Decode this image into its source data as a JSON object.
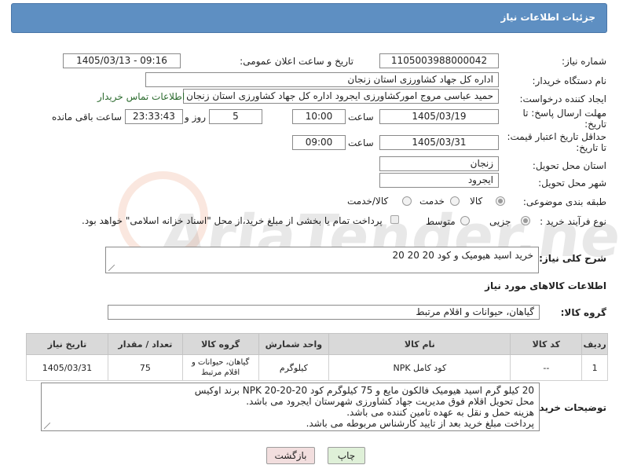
{
  "header": {
    "title": "جزئیات اطلاعات نیاز"
  },
  "form": {
    "need_number": {
      "label": "شماره نیاز:",
      "value": "1105003988000042"
    },
    "announce_datetime": {
      "label": "تاریخ و ساعت اعلان عمومی:",
      "value": "1405/03/13 - 09:16"
    },
    "buyer_org": {
      "label": "نام دستگاه خریدار:",
      "value": "اداره کل جهاد کشاورزی استان زنجان"
    },
    "creator": {
      "label": "ایجاد کننده درخواست:",
      "value": "حمید عباسی مروج امورکشاورزی ایجرود اداره کل جهاد کشاورزی استان زنجان",
      "contact_link": "اطلاعات تماس خریدار"
    },
    "reply_deadline": {
      "label_line1": "مهلت ارسال پاسخ: تا",
      "label_line2": "تاریخ:",
      "date": "1405/03/19",
      "time_label": "ساعت",
      "time": "10:00",
      "days": "5",
      "days_label": "روز و",
      "remaining": "23:33:43",
      "remaining_label": "ساعت باقی مانده"
    },
    "price_validity": {
      "label_line1": "حداقل تاریخ اعتبار قیمت:",
      "label_line2": "تا تاریخ:",
      "date": "1405/03/31",
      "time_label": "ساعت",
      "time": "09:00"
    },
    "province": {
      "label": "استان محل تحویل:",
      "value": "زنجان"
    },
    "city": {
      "label": "شهر محل تحویل:",
      "value": "ایجرود"
    },
    "category": {
      "label": "طبقه بندی موضوعی:",
      "options": [
        "کالا",
        "خدمت",
        "کالا/خدمت"
      ],
      "selected": "کالا"
    },
    "process": {
      "label": "نوع فرآیند خرید :",
      "options": [
        "جزیی",
        "متوسط"
      ],
      "selected": "جزیی",
      "payment_note": "پرداخت تمام یا بخشی از مبلغ خرید،از محل \"اسناد خزانه اسلامی\" خواهد بود."
    },
    "description": {
      "label": "شرح کلی نیاز:",
      "value": "خرید اسید هیومیک و کود 20 20 20"
    }
  },
  "goods": {
    "section_title": "اطلاعات کالاهای مورد نیاز",
    "group_label": "گروه کالا:",
    "group_value": "گیاهان، حیوانات و اقلام مرتبط",
    "table": {
      "headers": [
        "ردیف",
        "کد کالا",
        "نام کالا",
        "واحد شمارش",
        "گروه کالا",
        "تعداد / مقدار",
        "تاریخ نیاز"
      ],
      "rows": [
        [
          "1",
          "--",
          "کود کامل NPK",
          "کیلوگرم",
          "گیاهان، حیوانات و اقلام مرتبط",
          "75",
          "1405/03/31"
        ]
      ]
    }
  },
  "buyer_notes": {
    "label": "توضیحات خریدار:",
    "lines": [
      "20 کیلو گرم اسید هیومیک فالکون مایع و 75 کیلوگرم کود NPK 20-20-20 برند اوکیس",
      "محل تحویل اقلام فوق مدیریت جهاد کشاورزی شهرستان ایجرود می باشد.",
      "هزینه حمل و نقل به عهده تامین کننده می باشد.",
      "پرداخت مبلغ خرید بعد از تایید کارشناس مربوطه می باشد."
    ]
  },
  "buttons": {
    "print": "چاپ",
    "back": "بازگشت"
  },
  "watermark": "AriaTender.neT",
  "colors": {
    "header": "#5e8fc2",
    "link": "#2c6b2f",
    "print_btn": "#dff0d8",
    "back_btn": "#f2dede"
  }
}
